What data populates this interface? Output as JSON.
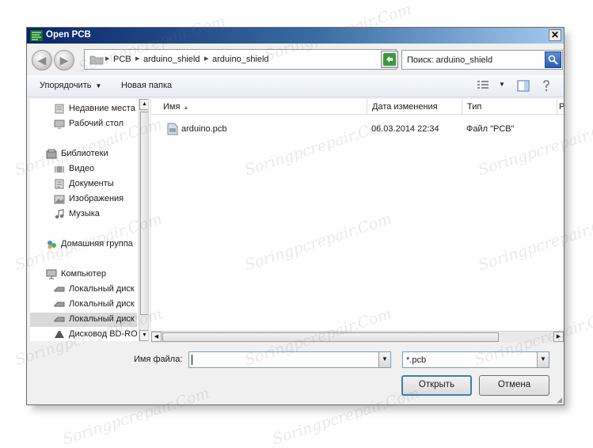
{
  "window": {
    "title": "Open PCB",
    "close_glyph": "✕"
  },
  "nav": {
    "back_icon": "back-arrow-icon",
    "forward_icon": "forward-arrow-icon",
    "breadcrumbs": [
      "PCB",
      "arduino_shield",
      "arduino_shield"
    ],
    "search_placeholder": "Поиск: arduino_shield"
  },
  "toolbar": {
    "organize_label": "Упорядочить",
    "new_folder_label": "Новая папка"
  },
  "sidebar": {
    "items": [
      {
        "label": "Недавние места",
        "icon": "recent-places-icon"
      },
      {
        "label": "Рабочий стол",
        "icon": "desktop-icon"
      },
      {
        "label": "Библиотеки",
        "icon": "libraries-icon"
      },
      {
        "label": "Видео",
        "icon": "video-icon"
      },
      {
        "label": "Документы",
        "icon": "documents-icon"
      },
      {
        "label": "Изображения",
        "icon": "images-icon"
      },
      {
        "label": "Музыка",
        "icon": "music-icon"
      },
      {
        "label": "Домашняя группа",
        "icon": "homegroup-icon"
      },
      {
        "label": "Компьютер",
        "icon": "computer-icon"
      },
      {
        "label": "Локальный диск",
        "icon": "disk-icon"
      },
      {
        "label": "Локальный диск",
        "icon": "disk-icon"
      },
      {
        "label": "Локальный диск",
        "icon": "disk-icon"
      },
      {
        "label": "Дисковод BD-RO",
        "icon": "bd-rom-icon"
      }
    ]
  },
  "files": {
    "columns": [
      "Имя",
      "Дата изменения",
      "Тип",
      "Р"
    ],
    "rows": [
      {
        "name": "arduino.pcb",
        "date": "06.03.2014 22:34",
        "type": "Файл \"PCB\""
      }
    ]
  },
  "bottom": {
    "filename_label": "Имя файла:",
    "filename_value": "",
    "filetype_value": "*.pcb",
    "open_label": "Открыть",
    "cancel_label": "Отмена"
  },
  "watermark_text": "Soringpcrepair.Com"
}
